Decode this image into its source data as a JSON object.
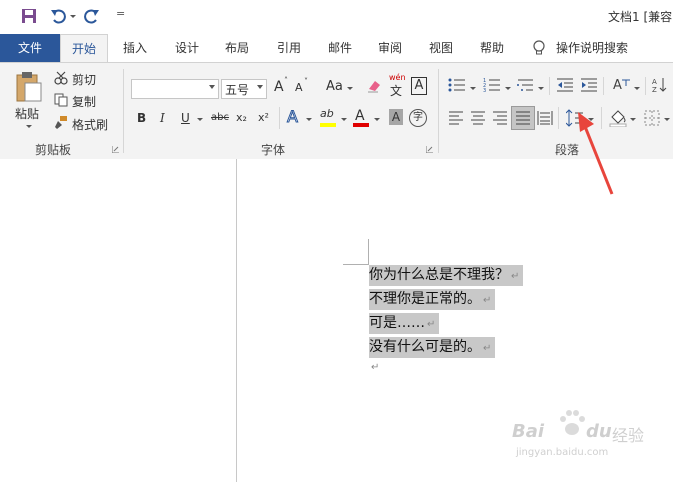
{
  "title": {
    "doc_name": "文档1 [兼容",
    "customize_glyph": "="
  },
  "tabs": [
    {
      "label": "文件"
    },
    {
      "label": "开始"
    },
    {
      "label": "插入"
    },
    {
      "label": "设计"
    },
    {
      "label": "布局"
    },
    {
      "label": "引用"
    },
    {
      "label": "邮件"
    },
    {
      "label": "审阅"
    },
    {
      "label": "视图"
    },
    {
      "label": "帮助"
    }
  ],
  "tell_me": "操作说明搜索",
  "clipboard": {
    "paste": "粘贴",
    "cut": "剪切",
    "copy": "复制",
    "format_painter": "格式刷",
    "group_label": "剪贴板"
  },
  "font": {
    "font_name": "",
    "font_size": "五号",
    "grow": "A",
    "shrink": "A",
    "case": "Aa",
    "phonetic_top": "wén",
    "phonetic_bottom": "文",
    "border_char": "A",
    "bold": "B",
    "italic": "I",
    "underline": "U",
    "strike": "abc",
    "subscript": "x₂",
    "superscript": "x²",
    "effect": "A",
    "highlight": "ab",
    "font_color": "A",
    "shading": "A",
    "enclose": "字",
    "group_label": "字体"
  },
  "paragraph": {
    "group_label": "段落"
  },
  "document": {
    "lines": [
      "你为什么总是不理我？",
      "不理你是正常的。",
      "可是……",
      "没有什么可是的。"
    ],
    "para_mark": "↵"
  },
  "watermark": {
    "brand": "Bai",
    "brand2": "du",
    "service": "经验",
    "url": "jingyan.baidu.com"
  },
  "colors": {
    "accent": "#2b579a",
    "highlight": "#ffff00",
    "font_color": "#e00000",
    "annotation": "#e8453c"
  }
}
